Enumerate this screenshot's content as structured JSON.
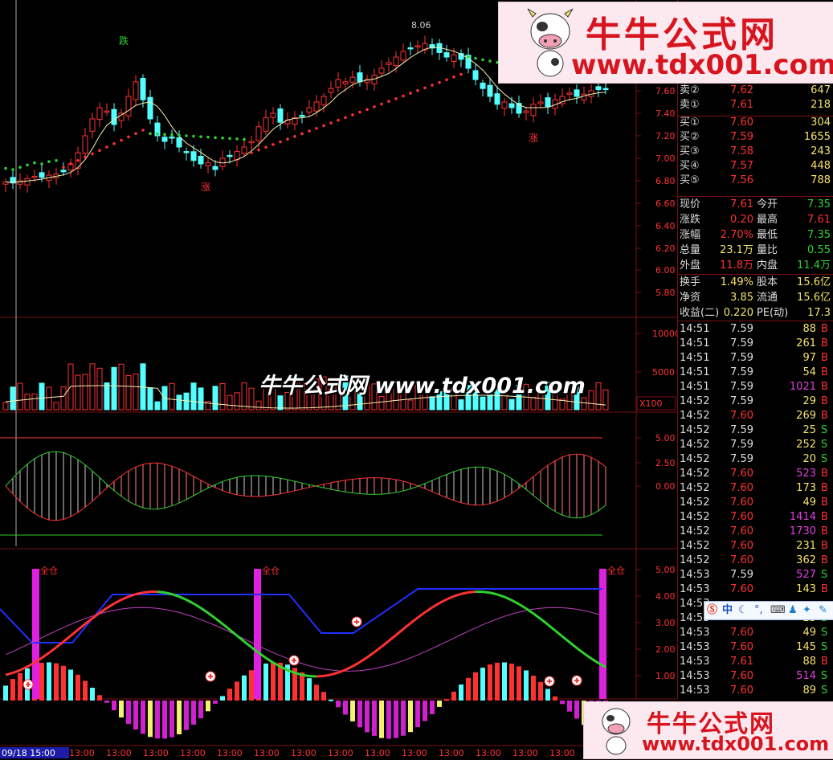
{
  "axis": {
    "price_ticks": [
      "7.60",
      "7.40",
      "7.20",
      "7.00",
      "6.80",
      "6.60",
      "6.40",
      "6.20",
      "6.00",
      "5.80"
    ],
    "volume_ticks": [
      "10000",
      "5000"
    ],
    "volume_unit": "X100",
    "macd_ticks": [
      "5.00",
      "2.50",
      "0.00"
    ],
    "ind_ticks": [
      "5.00",
      "4.00",
      "3.00",
      "2.00",
      "1.00"
    ],
    "time_labels": [
      "09/18 15:00",
      "13:00",
      "13:00",
      "13:00",
      "13:00",
      "13:00",
      "13:00",
      "13:00",
      "13:00",
      "13:00",
      "13:00",
      "13:00",
      "13:00",
      "13:00",
      "13:00",
      "13:00",
      "13:00",
      "13:00"
    ]
  },
  "marks": {
    "die": "跌",
    "zhang1": "涨",
    "zhang2": "涨",
    "peak": "8.06",
    "quancang": "全仓"
  },
  "quotes": {
    "order_book": [
      {
        "label": "卖②",
        "price": "7.62",
        "vol": "647"
      },
      {
        "label": "卖①",
        "price": "7.61",
        "vol": "218"
      },
      {
        "label": "买①",
        "price": "7.60",
        "vol": "304"
      },
      {
        "label": "买②",
        "price": "7.59",
        "vol": "1655"
      },
      {
        "label": "买③",
        "price": "7.58",
        "vol": "243"
      },
      {
        "label": "买④",
        "price": "7.57",
        "vol": "448"
      },
      {
        "label": "买⑤",
        "price": "7.56",
        "vol": "788"
      }
    ],
    "stats": [
      {
        "l1": "现价",
        "v1": "7.61",
        "l2": "今开",
        "v2": "7.35"
      },
      {
        "l1": "涨跌",
        "v1": "0.20",
        "l2": "最高",
        "v2": "7.61"
      },
      {
        "l1": "涨幅",
        "v1": "2.70%",
        "l2": "最低",
        "v2": "7.35"
      },
      {
        "l1": "总量",
        "v1": "23.1万",
        "l2": "量比",
        "v2": "0.55"
      },
      {
        "l1": "外盘",
        "v1": "11.8万",
        "l2": "内盘",
        "v2": "11.4万"
      }
    ],
    "stats2": [
      {
        "l1": "换手",
        "v1": "1.49%",
        "l2": "股本",
        "v2": "15.6亿"
      },
      {
        "l1": "净资",
        "v1": "3.85",
        "l2": "流通",
        "v2": "15.6亿"
      },
      {
        "l1": "收益(二)",
        "v1": "0.220",
        "l2": "PE(动)",
        "v2": "17.3"
      }
    ],
    "ticks": [
      {
        "t": "14:51",
        "p": "7.59",
        "v": "88",
        "d": "B"
      },
      {
        "t": "14:51",
        "p": "7.59",
        "v": "261",
        "d": "B"
      },
      {
        "t": "14:51",
        "p": "7.59",
        "v": "97",
        "d": "B"
      },
      {
        "t": "14:51",
        "p": "7.59",
        "v": "54",
        "d": "B"
      },
      {
        "t": "14:51",
        "p": "7.59",
        "v": "1021",
        "d": "B"
      },
      {
        "t": "14:52",
        "p": "7.59",
        "v": "29",
        "d": "B"
      },
      {
        "t": "14:52",
        "p": "7.60",
        "v": "269",
        "d": "B"
      },
      {
        "t": "14:52",
        "p": "7.59",
        "v": "25",
        "d": "S"
      },
      {
        "t": "14:52",
        "p": "7.59",
        "v": "252",
        "d": "S"
      },
      {
        "t": "14:52",
        "p": "7.59",
        "v": "20",
        "d": "S"
      },
      {
        "t": "14:52",
        "p": "7.60",
        "v": "523",
        "d": "B"
      },
      {
        "t": "14:52",
        "p": "7.60",
        "v": "173",
        "d": "B"
      },
      {
        "t": "14:52",
        "p": "7.60",
        "v": "49",
        "d": "B"
      },
      {
        "t": "14:52",
        "p": "7.60",
        "v": "1414",
        "d": "B"
      },
      {
        "t": "14:52",
        "p": "7.60",
        "v": "1730",
        "d": "B"
      },
      {
        "t": "14:52",
        "p": "7.60",
        "v": "231",
        "d": "B"
      },
      {
        "t": "14:52",
        "p": "7.60",
        "v": "362",
        "d": "B"
      },
      {
        "t": "14:53",
        "p": "7.59",
        "v": "527",
        "d": "S"
      },
      {
        "t": "14:53",
        "p": "7.60",
        "v": "143",
        "d": "B"
      },
      {
        "t": "14:53",
        "p": "",
        "v": "",
        "d": ""
      },
      {
        "t": "14:53",
        "p": "",
        "v": "25",
        "d": "S"
      },
      {
        "t": "14:53",
        "p": "7.60",
        "v": "49",
        "d": "S"
      },
      {
        "t": "14:53",
        "p": "7.60",
        "v": "145",
        "d": "S"
      },
      {
        "t": "14:53",
        "p": "7.61",
        "v": "88",
        "d": "B"
      },
      {
        "t": "14:53",
        "p": "7.60",
        "v": "514",
        "d": "S"
      },
      {
        "t": "14:53",
        "p": "7.60",
        "v": "89",
        "d": "S"
      }
    ]
  },
  "banner": {
    "title": "牛牛公式网",
    "url": "www.tdx001.com"
  },
  "watermark": "牛牛公式网 www.tdx001.com",
  "ime_text": "中",
  "colors": {
    "up": "#ff3232",
    "down": "#54ffff",
    "bg": "#000000",
    "grid": "#7a1010"
  }
}
